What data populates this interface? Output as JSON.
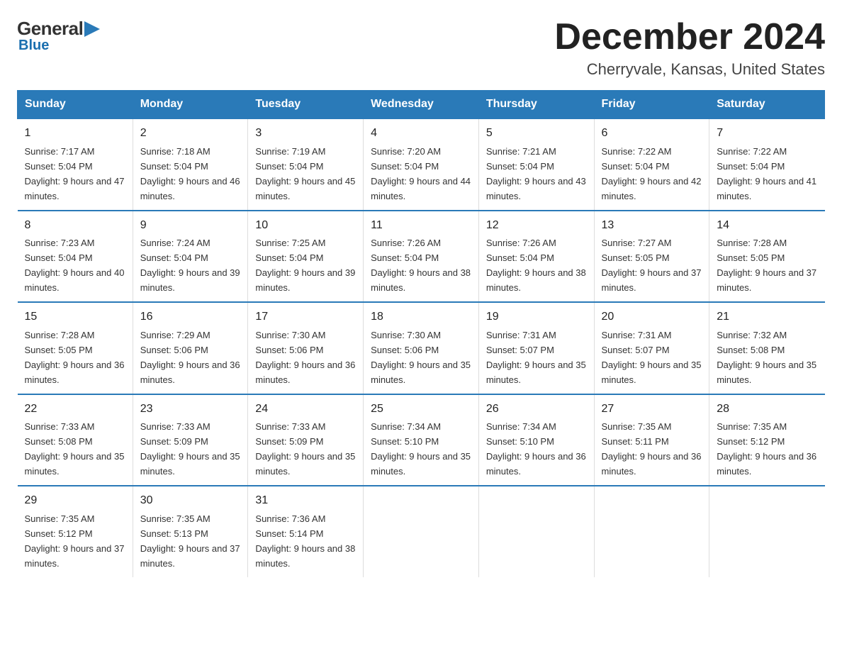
{
  "logo": {
    "general": "General",
    "blue": "Blue"
  },
  "header": {
    "month": "December 2024",
    "location": "Cherryvale, Kansas, United States"
  },
  "weekdays": [
    "Sunday",
    "Monday",
    "Tuesday",
    "Wednesday",
    "Thursday",
    "Friday",
    "Saturday"
  ],
  "weeks": [
    [
      {
        "day": "1",
        "sunrise": "7:17 AM",
        "sunset": "5:04 PM",
        "daylight": "9 hours and 47 minutes."
      },
      {
        "day": "2",
        "sunrise": "7:18 AM",
        "sunset": "5:04 PM",
        "daylight": "9 hours and 46 minutes."
      },
      {
        "day": "3",
        "sunrise": "7:19 AM",
        "sunset": "5:04 PM",
        "daylight": "9 hours and 45 minutes."
      },
      {
        "day": "4",
        "sunrise": "7:20 AM",
        "sunset": "5:04 PM",
        "daylight": "9 hours and 44 minutes."
      },
      {
        "day": "5",
        "sunrise": "7:21 AM",
        "sunset": "5:04 PM",
        "daylight": "9 hours and 43 minutes."
      },
      {
        "day": "6",
        "sunrise": "7:22 AM",
        "sunset": "5:04 PM",
        "daylight": "9 hours and 42 minutes."
      },
      {
        "day": "7",
        "sunrise": "7:22 AM",
        "sunset": "5:04 PM",
        "daylight": "9 hours and 41 minutes."
      }
    ],
    [
      {
        "day": "8",
        "sunrise": "7:23 AM",
        "sunset": "5:04 PM",
        "daylight": "9 hours and 40 minutes."
      },
      {
        "day": "9",
        "sunrise": "7:24 AM",
        "sunset": "5:04 PM",
        "daylight": "9 hours and 39 minutes."
      },
      {
        "day": "10",
        "sunrise": "7:25 AM",
        "sunset": "5:04 PM",
        "daylight": "9 hours and 39 minutes."
      },
      {
        "day": "11",
        "sunrise": "7:26 AM",
        "sunset": "5:04 PM",
        "daylight": "9 hours and 38 minutes."
      },
      {
        "day": "12",
        "sunrise": "7:26 AM",
        "sunset": "5:04 PM",
        "daylight": "9 hours and 38 minutes."
      },
      {
        "day": "13",
        "sunrise": "7:27 AM",
        "sunset": "5:05 PM",
        "daylight": "9 hours and 37 minutes."
      },
      {
        "day": "14",
        "sunrise": "7:28 AM",
        "sunset": "5:05 PM",
        "daylight": "9 hours and 37 minutes."
      }
    ],
    [
      {
        "day": "15",
        "sunrise": "7:28 AM",
        "sunset": "5:05 PM",
        "daylight": "9 hours and 36 minutes."
      },
      {
        "day": "16",
        "sunrise": "7:29 AM",
        "sunset": "5:06 PM",
        "daylight": "9 hours and 36 minutes."
      },
      {
        "day": "17",
        "sunrise": "7:30 AM",
        "sunset": "5:06 PM",
        "daylight": "9 hours and 36 minutes."
      },
      {
        "day": "18",
        "sunrise": "7:30 AM",
        "sunset": "5:06 PM",
        "daylight": "9 hours and 35 minutes."
      },
      {
        "day": "19",
        "sunrise": "7:31 AM",
        "sunset": "5:07 PM",
        "daylight": "9 hours and 35 minutes."
      },
      {
        "day": "20",
        "sunrise": "7:31 AM",
        "sunset": "5:07 PM",
        "daylight": "9 hours and 35 minutes."
      },
      {
        "day": "21",
        "sunrise": "7:32 AM",
        "sunset": "5:08 PM",
        "daylight": "9 hours and 35 minutes."
      }
    ],
    [
      {
        "day": "22",
        "sunrise": "7:33 AM",
        "sunset": "5:08 PM",
        "daylight": "9 hours and 35 minutes."
      },
      {
        "day": "23",
        "sunrise": "7:33 AM",
        "sunset": "5:09 PM",
        "daylight": "9 hours and 35 minutes."
      },
      {
        "day": "24",
        "sunrise": "7:33 AM",
        "sunset": "5:09 PM",
        "daylight": "9 hours and 35 minutes."
      },
      {
        "day": "25",
        "sunrise": "7:34 AM",
        "sunset": "5:10 PM",
        "daylight": "9 hours and 35 minutes."
      },
      {
        "day": "26",
        "sunrise": "7:34 AM",
        "sunset": "5:10 PM",
        "daylight": "9 hours and 36 minutes."
      },
      {
        "day": "27",
        "sunrise": "7:35 AM",
        "sunset": "5:11 PM",
        "daylight": "9 hours and 36 minutes."
      },
      {
        "day": "28",
        "sunrise": "7:35 AM",
        "sunset": "5:12 PM",
        "daylight": "9 hours and 36 minutes."
      }
    ],
    [
      {
        "day": "29",
        "sunrise": "7:35 AM",
        "sunset": "5:12 PM",
        "daylight": "9 hours and 37 minutes."
      },
      {
        "day": "30",
        "sunrise": "7:35 AM",
        "sunset": "5:13 PM",
        "daylight": "9 hours and 37 minutes."
      },
      {
        "day": "31",
        "sunrise": "7:36 AM",
        "sunset": "5:14 PM",
        "daylight": "9 hours and 38 minutes."
      },
      null,
      null,
      null,
      null
    ]
  ]
}
